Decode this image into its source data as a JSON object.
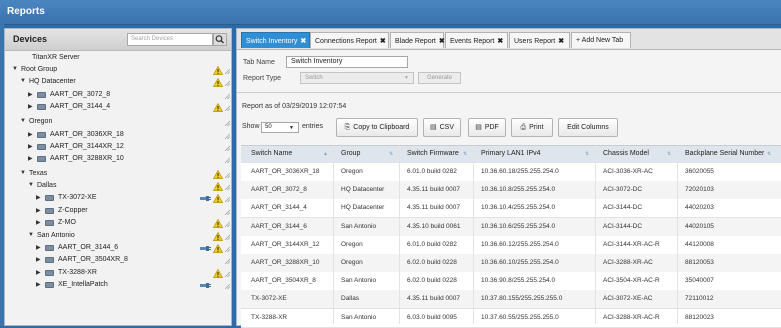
{
  "app": {
    "title": "Reports"
  },
  "devices": {
    "title": "Devices",
    "search_placeholder": "Search Devices",
    "tree": [
      {
        "label": "TitanXR Server",
        "toggle": "",
        "icon": false,
        "warn": false,
        "plug": false
      },
      {
        "label": "Root Group",
        "toggle": "▼",
        "icon": false,
        "warn": true,
        "plug": false
      },
      {
        "label": "HQ Datacenter",
        "toggle": "▼",
        "icon": false,
        "warn": true,
        "plug": false
      },
      {
        "label": "AART_OR_3072_8",
        "toggle": "▶",
        "icon": true,
        "warn": false,
        "plug": false
      },
      {
        "label": "AART_OR_3144_4",
        "toggle": "▶",
        "icon": true,
        "warn": true,
        "plug": false
      },
      {
        "label": "Oregon",
        "toggle": "▼",
        "icon": false,
        "warn": false,
        "plug": false
      },
      {
        "label": "AART_OR_3036XR_18",
        "toggle": "▶",
        "icon": true,
        "warn": false,
        "plug": false
      },
      {
        "label": "AART_OR_3144XR_12",
        "toggle": "▶",
        "icon": true,
        "warn": false,
        "plug": false
      },
      {
        "label": "AART_OR_3288XR_10",
        "toggle": "▶",
        "icon": true,
        "warn": false,
        "plug": false
      },
      {
        "label": "Texas",
        "toggle": "▼",
        "icon": false,
        "warn": true,
        "plug": false
      },
      {
        "label": "Dallas",
        "toggle": "▼",
        "icon": false,
        "warn": true,
        "plug": false
      },
      {
        "label": "TX-3072-XE",
        "toggle": "▶",
        "icon": true,
        "warn": true,
        "plug": true
      },
      {
        "label": "Z-Copper",
        "toggle": "▶",
        "icon": true,
        "warn": false,
        "plug": false
      },
      {
        "label": "Z-MO",
        "toggle": "▶",
        "icon": true,
        "warn": true,
        "plug": false
      },
      {
        "label": "San Antonio",
        "toggle": "▼",
        "icon": false,
        "warn": true,
        "plug": false
      },
      {
        "label": "AART_OR_3144_6",
        "toggle": "▶",
        "icon": true,
        "warn": true,
        "plug": true
      },
      {
        "label": "AART_OR_3504XR_8",
        "toggle": "▶",
        "icon": true,
        "warn": false,
        "plug": false
      },
      {
        "label": "TX-3288-XR",
        "toggle": "▶",
        "icon": true,
        "warn": true,
        "plug": false
      },
      {
        "label": "XE_IntellaPatch",
        "toggle": "▶",
        "icon": true,
        "warn": false,
        "plug": true
      }
    ]
  },
  "tabs": [
    {
      "label": "Switch Inventory",
      "active": true
    },
    {
      "label": "Connections Report",
      "active": false
    },
    {
      "label": "Blade Report",
      "active": false
    },
    {
      "label": "Events Report",
      "active": false
    },
    {
      "label": "Users Report",
      "active": false
    }
  ],
  "add_tab_label": "+ Add New Tab",
  "form": {
    "tab_name_label": "Tab Name",
    "tab_name_value": "Switch Inventory",
    "report_type_label": "Report Type",
    "report_type_value": "Switch",
    "generate_label": "Generate"
  },
  "report_as": "Report as of 03/29/2019 12:07:54",
  "show": {
    "label": "Show",
    "value": "50",
    "suffix": "entries"
  },
  "buttons": {
    "copy": "Copy to Clipboard",
    "csv": "CSV",
    "pdf": "PDF",
    "print": "Print",
    "edit_columns": "Edit Columns"
  },
  "table": {
    "columns": [
      "Switch Name",
      "Group",
      "Switch Firmware",
      "Primary LAN1 IPv4",
      "Chassis Model",
      "Backplane Serial Number"
    ],
    "rows": [
      [
        "AART_OR_3036XR_18",
        "Oregon",
        "6.01.0 build 0282",
        "10.36.60.18/255.255.254.0",
        "ACI-3036-XR-AC",
        "36020055"
      ],
      [
        "AART_OR_3072_8",
        "HQ Datacenter",
        "4.35.11 build 0007",
        "10.36.10.8/255.255.254.0",
        "ACI-3072-DC",
        "72020103"
      ],
      [
        "AART_OR_3144_4",
        "HQ Datacenter",
        "4.35.11 build 0007",
        "10.36.10.4/255.255.254.0",
        "ACI-3144-DC",
        "44020203"
      ],
      [
        "AART_OR_3144_6",
        "San Antonio",
        "4.35.10 build 0061",
        "10.36.10.6/255.255.254.0",
        "ACI-3144-DC",
        "44020105"
      ],
      [
        "AART_OR_3144XR_12",
        "Oregon",
        "6.01.0 build 0282",
        "10.36.60.12/255.255.254.0",
        "ACI-3144-XR-AC-R",
        "44120008"
      ],
      [
        "AART_OR_3288XR_10",
        "Oregon",
        "6.02.0 build 0228",
        "10.36.60.10/255.255.254.0",
        "ACI-3288-XR-AC",
        "88120053"
      ],
      [
        "AART_OR_3504XR_8",
        "San Antonio",
        "6.02.0 build 0228",
        "10.36.90.8/255.255.254.0",
        "ACI-3504-XR-AC-R",
        "35040007"
      ],
      [
        "TX-3072-XE",
        "Dallas",
        "4.35.11 build 0007",
        "10.37.80.155/255.255.255.0",
        "ACI-3072-XE-AC",
        "72110012"
      ],
      [
        "TX-3288-XR",
        "San Antonio",
        "6.03.0 build 0095",
        "10.37.60.55/255.255.255.0",
        "ACI-3288-XR-AC-R",
        "88120023"
      ]
    ]
  }
}
